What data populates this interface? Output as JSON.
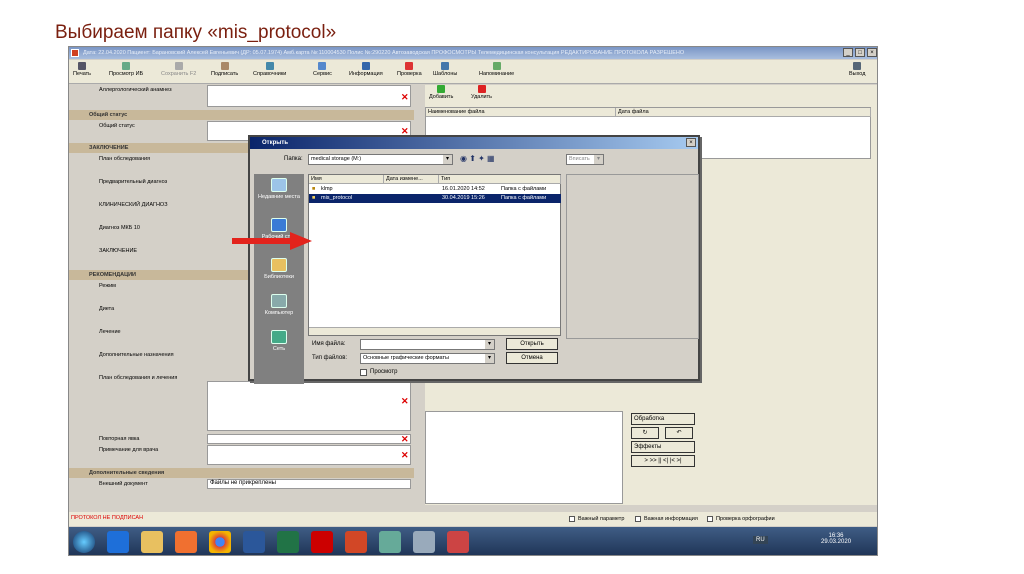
{
  "slide_title": "Выбираем папку «mis_protocol»",
  "window": {
    "title": "Дата: 22.04.2020 Пациент: Барановский Алексей Евгеньевич (ДР: 05.07.1974) Амб.карта №:110004530 Полис №:290220 Автозаводская ПРОФОСМОТРЫ Телемедицинская консультация РЕДАКТИРОВАНИЕ ПРОТОКОЛА РАЗРЕШЕНО"
  },
  "toolbar": {
    "print": "Печать",
    "preview": "Просмотр ИБ",
    "save": "Сохранить F2",
    "sign": "Подписать",
    "refs": "Справочники",
    "service": "Сервис",
    "info": "Информация",
    "check": "Проверка",
    "templates": "Шаблоны",
    "reminder": "Напоминание",
    "exit": "Выход"
  },
  "form": {
    "allergy": "Аллергологический анамнез",
    "sec_general": "Общий статус",
    "general": "Общий статус",
    "sec_concl": "ЗАКЛЮЧЕНИЕ",
    "exam_plan": "План обследования",
    "prelim": "Предварительный диагноз",
    "clinical": "КЛИНИЧЕСКИЙ ДИАГНОЗ",
    "mkb": "Диагноз МКБ 10",
    "concl": "ЗАКЛЮЧЕНИЕ",
    "sec_rec": "РЕКОМЕНДАЦИИ",
    "regime": "Режим",
    "diet": "Диета",
    "treatment": "Лечение",
    "extra": "Дополнительные назначения",
    "exam_treat": "План обследования и лечения",
    "repeat": "Повторная явка",
    "note": "Примечание для врача",
    "sec_more": "Дополнительные сведения",
    "ext_doc": "Внешний документ",
    "ext_doc_value": "Файлы не прикреплены",
    "status": "ПРОТОКОЛ НЕ ПОДПИСАН"
  },
  "right": {
    "add": "Добавить",
    "delete": "Удалить",
    "col_name": "Наименование файла",
    "col_date": "Дата файла",
    "processing": "Обработка",
    "effects": "Эффекты",
    "nav": "> >> || <| |< >|"
  },
  "dialog": {
    "title": "Открыть",
    "folder_label": "Папка:",
    "folder": "medical storage (M:)",
    "view": "Вписать",
    "places": [
      "Недавние места",
      "Рабочий стол",
      "Библиотеки",
      "Компьютер",
      "Сеть"
    ],
    "cols": [
      "Имя",
      "Дата измене...",
      "Тип"
    ],
    "files": [
      {
        "name": "klmp",
        "date": "16.01.2020 14:52",
        "type": "Папка с файлами"
      },
      {
        "name": "mis_protocol",
        "date": "30.04.2019 15:26",
        "type": "Папка с файлами"
      }
    ],
    "filename_label": "Имя файла:",
    "filetype_label": "Тип файлов:",
    "filetype": "Основные графические форматы",
    "open": "Открыть",
    "cancel": "Отмена",
    "preview": "Просмотр"
  },
  "checks": {
    "c1": "Важный параметр",
    "c2": "Важная информация",
    "c3": "Проверка орфографии"
  },
  "taskbar": {
    "lang": "RU",
    "time": "16:36",
    "date": "29.03.2020"
  }
}
